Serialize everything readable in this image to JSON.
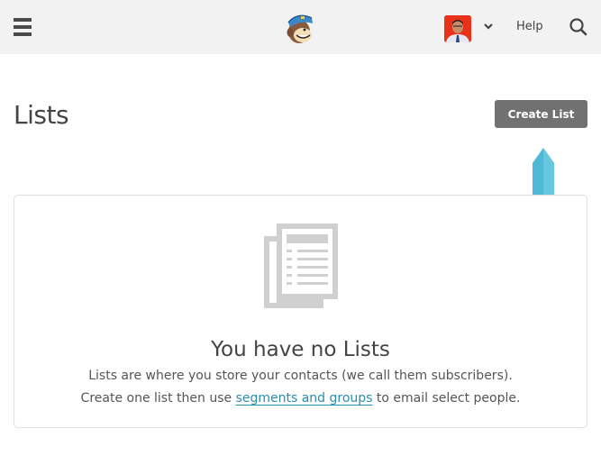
{
  "topbar": {
    "menu_icon": "hamburger-menu-icon",
    "logo_icon": "mailchimp-freddie-logo",
    "avatar_icon": "user-avatar",
    "account_caret_icon": "chevron-down-icon",
    "help_label": "Help",
    "search_icon": "search-icon"
  },
  "page": {
    "title": "Lists",
    "create_button_label": "Create List"
  },
  "empty_state": {
    "icon": "document-list-icon",
    "title": "You have no Lists",
    "line1": "Lists are where you store your contacts (we call them subscribers).",
    "line2_before": "Create one list then use ",
    "line2_link": "segments and groups",
    "line2_after": " to email select people."
  },
  "colors": {
    "topbar_bg": "#f2f2f2",
    "button_bg": "#717171",
    "link": "#2a8cab",
    "pointer": "#52bad6"
  }
}
